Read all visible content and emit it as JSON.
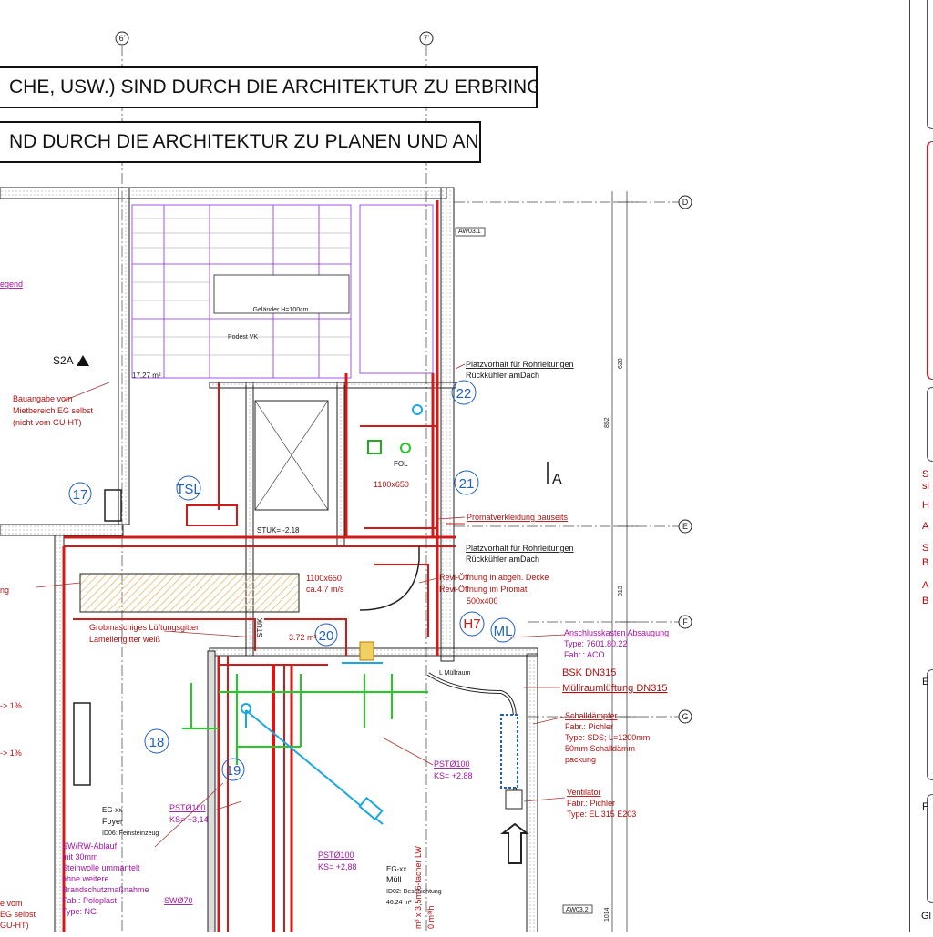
{
  "notes": {
    "note1": "CHE, USW.) SIND DURCH DIE ARCHITEKTUR ZU ERBRINGEN.",
    "note2": "ND DURCH DIE ARCHITEKTUR ZU PLANEN UND ANZUGEBEN."
  },
  "grid": {
    "col_a": "6'",
    "col_b": "7'",
    "row_d": "D",
    "row_e": "E",
    "row_f": "F",
    "row_g": "G"
  },
  "markers": {
    "m22": "22",
    "m21": "21",
    "m17": "17",
    "mtsl": "TSL",
    "m20": "20",
    "m18": "18",
    "m19": "19",
    "mh7": "H7",
    "mml": "ML",
    "s2a": "S2A",
    "a": "A"
  },
  "labels": {
    "legend": "egend",
    "bauangabe1": "Bauangabe vom",
    "bauangabe2": "Mietbereich EG selbst",
    "bauangabe3": "(nicht vom GU-HT)",
    "platz1a": "Platzvorhalt für Rohrleitungen",
    "platz1b": "Rückkühler amDach",
    "platz2a": "Platzvorhalt für Rohrleitungen",
    "platz2b": "Rückkühler amDach",
    "promat": "Promatverkleidung bauseits",
    "revi1": "Revi-Öffnung in abgeh. Decke",
    "revi2": "Revi-Öffnung im Promat",
    "duct1100a": "1100x650",
    "duct1100b": "1100x650",
    "duct_speed": "ca.4,7 m/s",
    "duct500": "500x400",
    "grob1": "Grobmaschiges Lüftungsgitter",
    "grob2": "Lamellengitter weiß",
    "ansch1": "Anschlusskasten Absaugung",
    "ansch2": "Type: 7601.80.22",
    "ansch3": "Fabr.: ACO",
    "bsk": "BSK DN315",
    "mull_luft": "Müllraumlüftung DN315",
    "schall1": "Schalldämpfer",
    "schall2": "Fabr.: Pichler",
    "schall3": "Type: SDS; L=1200mm",
    "schall4": "50mm Schalldämm-",
    "schall5": "packung",
    "vent1": "Ventilator",
    "vent2": "Fabr.: Pichler",
    "vent3": "Type: EL 315 E203",
    "pst1a": "PSTØ100",
    "pst1b": "KS= +2,88",
    "pst2a": "PSTØ100",
    "pst2b": "KS= +3,14",
    "pst3a": "PSTØ100",
    "pst3b": "KS= +2,88",
    "sw1": "SW/RW-Ablauf",
    "sw2": "mit 30mm",
    "sw3": "Steinwolle ummantelt",
    "sw4": "ohne weitere",
    "sw5": "Brandschutzmaßnahme",
    "sw6": "Fab.: Poloplast",
    "sw7": "Type: NG",
    "sw70": "SWØ70",
    "foyer1": "EG-xx",
    "foyer2": "Foyer",
    "foyer3": "ID06: Feinsteinzeug",
    "mull1": "EG-xx",
    "mull2": "Müll",
    "mull3": "ID02: Beschichtung",
    "mull4": "46.24 m²",
    "slope1": "-> 1%",
    "slope2": "-> 1%",
    "bottom_left1": "e vom",
    "bottom_left2": "EG selbst",
    "bottom_left3": "GU-HT)",
    "ng": "ng",
    "gelander": "Geländer H=100cm",
    "podest": "Podest VK",
    "stuk1": "STUK= -2.18",
    "stuk2": "STUK",
    "aw1": "AW03.1",
    "aw2": "AW03.2",
    "lmull": "L Müllraum",
    "fol": "FOL",
    "dim_628": "628",
    "dim_852": "852",
    "dim_313": "313",
    "dim_1014": "1014",
    "dim_3_72": "3.72 m²",
    "fachluft": "m³ x 3,5m 6-facher LW",
    "fachluft2": "0 m³/h",
    "area": "17.27 m²"
  },
  "right_panel": {
    "t1": "S",
    "t2": "si",
    "t3": "H",
    "t4": "A",
    "t5": "S",
    "t6": "B",
    "t7": "A",
    "t8": "B",
    "t9": "E",
    "t10": "F",
    "t11": "Gl"
  },
  "colors": {
    "ink": "#111111",
    "wall": "#d11a1a",
    "duct_green": "#22cc22",
    "pipe_blue": "#1aa7e0",
    "note_purple": "#a0149e",
    "room_hatch": "#e0c070",
    "marker_blue": "#1f5fbf"
  }
}
